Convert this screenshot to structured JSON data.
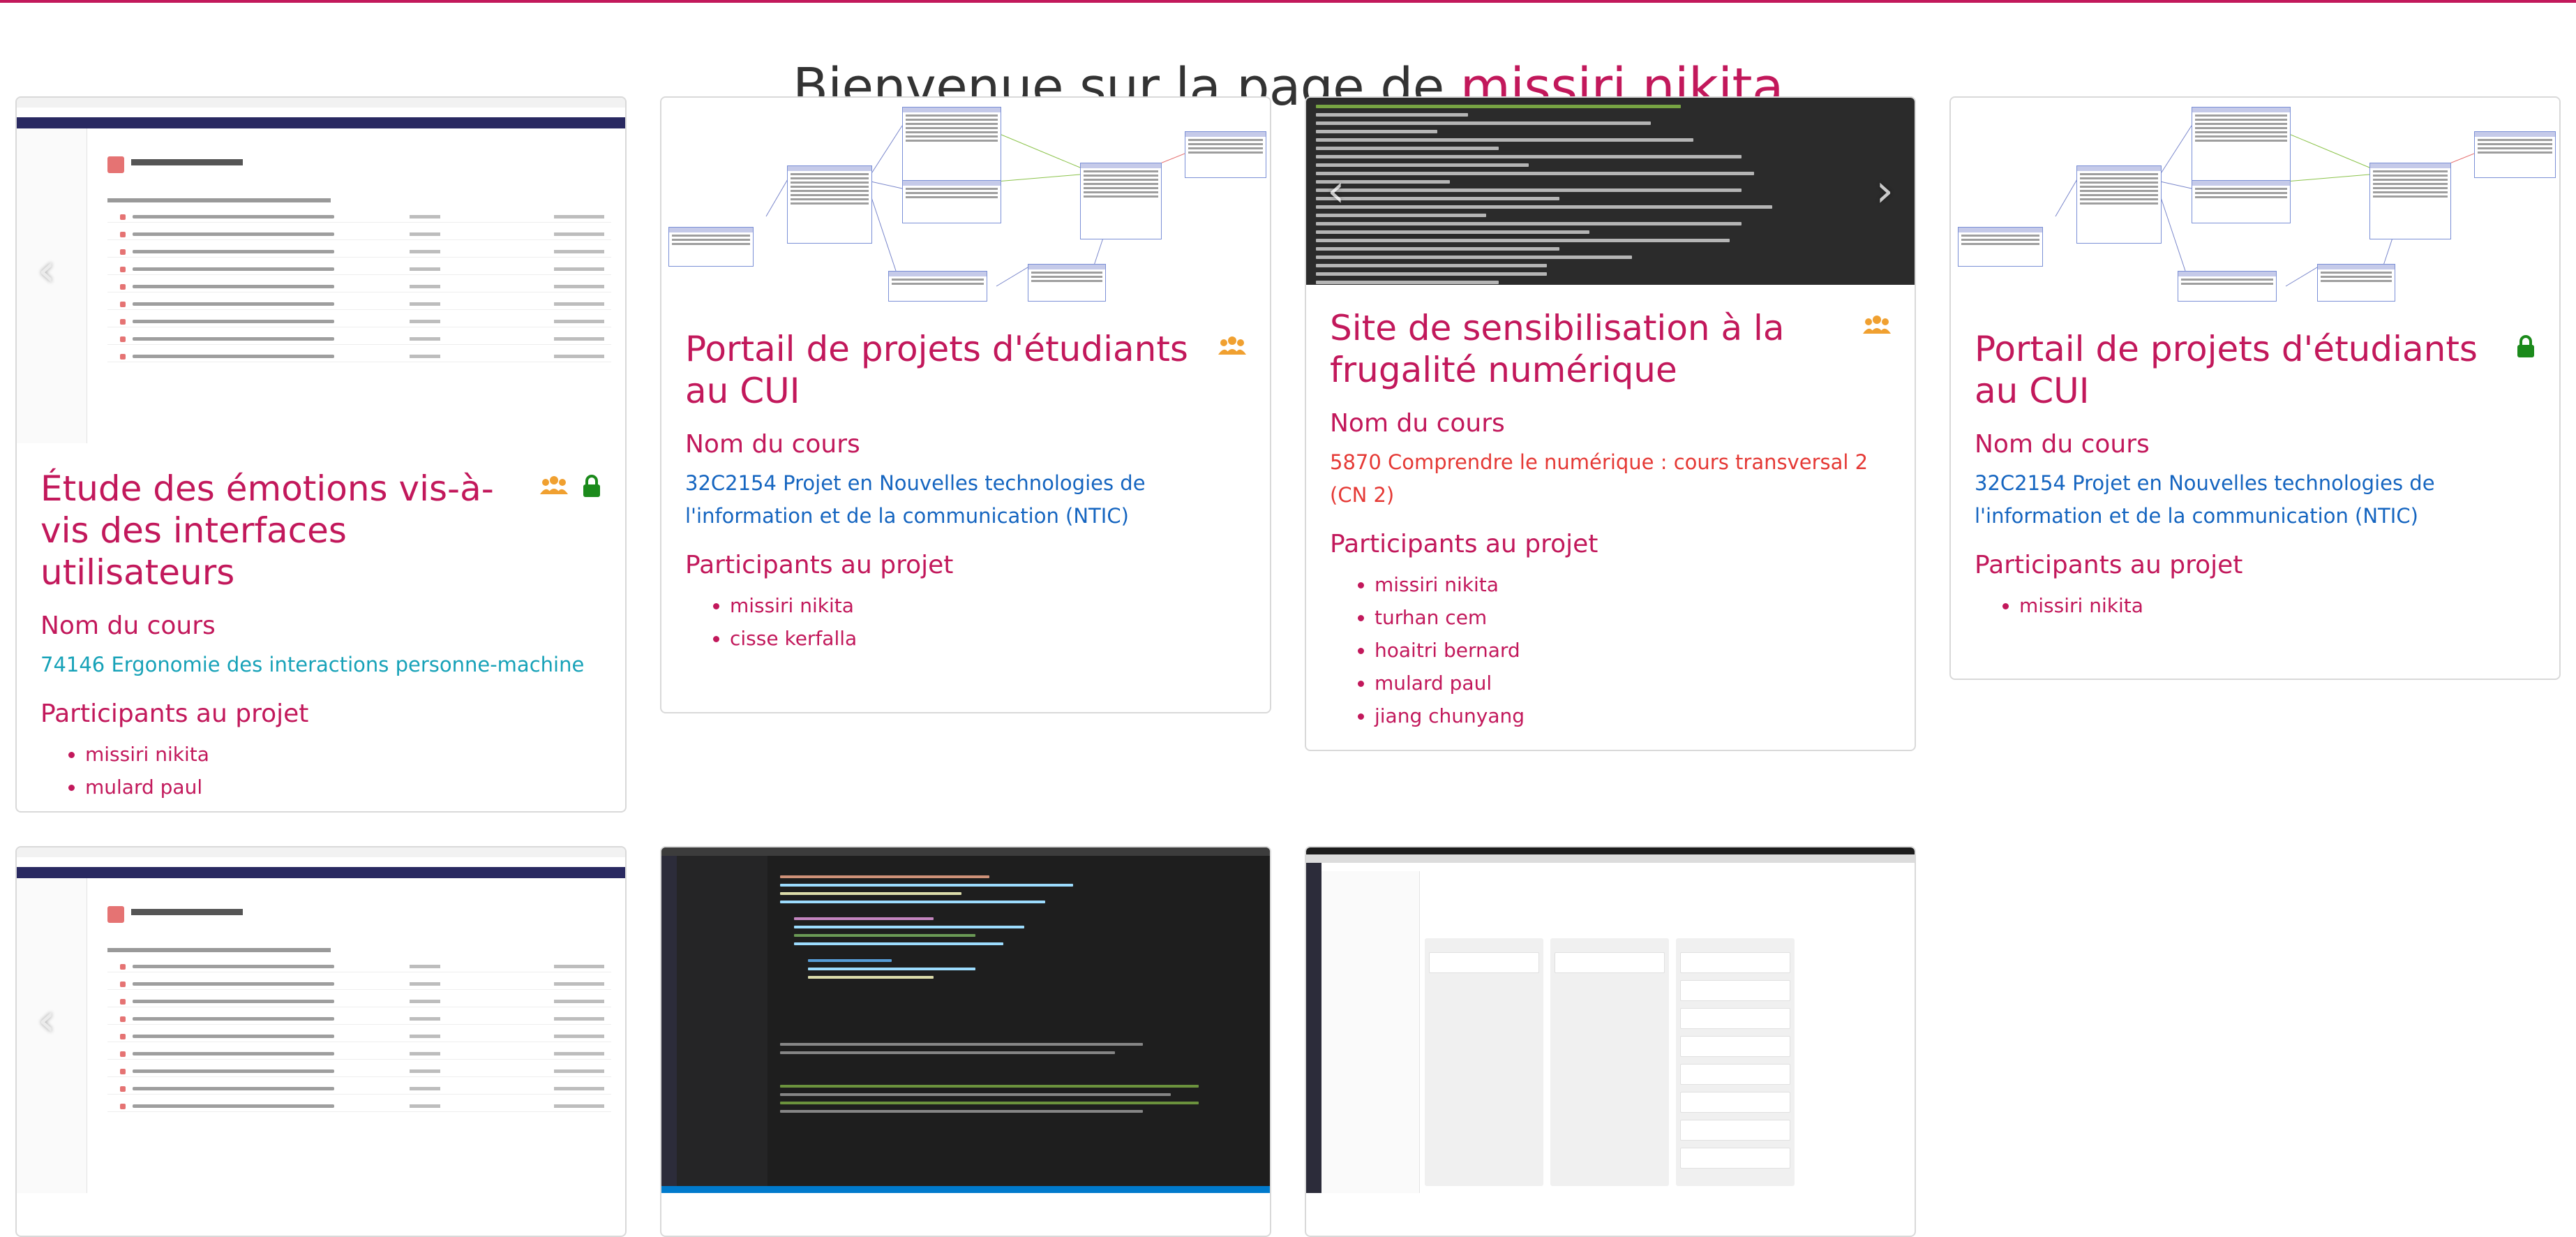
{
  "header": {
    "welcome": "Bienvenue sur la page de",
    "user_name": "missiri nikita"
  },
  "carousel_controls": {
    "prev": "‹",
    "next": "›"
  },
  "projects": [
    {
      "title": "Étude des émotions vis-à-vis des interfaces utilisateurs",
      "course_heading": "Nom du cours",
      "course": "74146 Ergonomie des interactions personne-machine",
      "participants_heading": "Participants au projet",
      "participants": [
        "missiri nikita",
        "mulard paul"
      ],
      "icons": [
        "group-icon",
        "lock-icon"
      ]
    },
    {
      "title": "Portail de projets d'étudiants au CUI",
      "course_heading": "Nom du cours",
      "course": "32C2154 Projet en Nouvelles technologies de l'information et de la communication (NTIC)",
      "participants_heading": "Participants au projet",
      "participants": [
        "missiri nikita",
        "cisse kerfalla"
      ],
      "icons": [
        "group-icon"
      ]
    },
    {
      "title": "Site de sensibilisation à la frugalité numérique",
      "course_heading": "Nom du cours",
      "course": "5870 Comprendre le numérique : cours transversal 2 (CN 2)",
      "participants_heading": "Participants au projet",
      "participants": [
        "missiri nikita",
        "turhan cem",
        "hoaitri bernard",
        "mulard paul",
        "jiang chunyang"
      ],
      "icons": [
        "group-icon"
      ]
    },
    {
      "title": "Portail de projets d'étudiants au CUI",
      "course_heading": "Nom du cours",
      "course": "32C2154 Projet en Nouvelles technologies de l'information et de la communication (NTIC)",
      "participants_heading": "Participants au projet",
      "participants": [
        "missiri nikita"
      ],
      "icons": [
        "lock-icon"
      ]
    }
  ],
  "colors": {
    "accent": "#c2185b",
    "group_icon": "#f0a030",
    "lock_icon": "#1b8a1b",
    "course_blue": "#1565c0",
    "course_teal": "#17a2b8",
    "course_red": "#e53935"
  }
}
